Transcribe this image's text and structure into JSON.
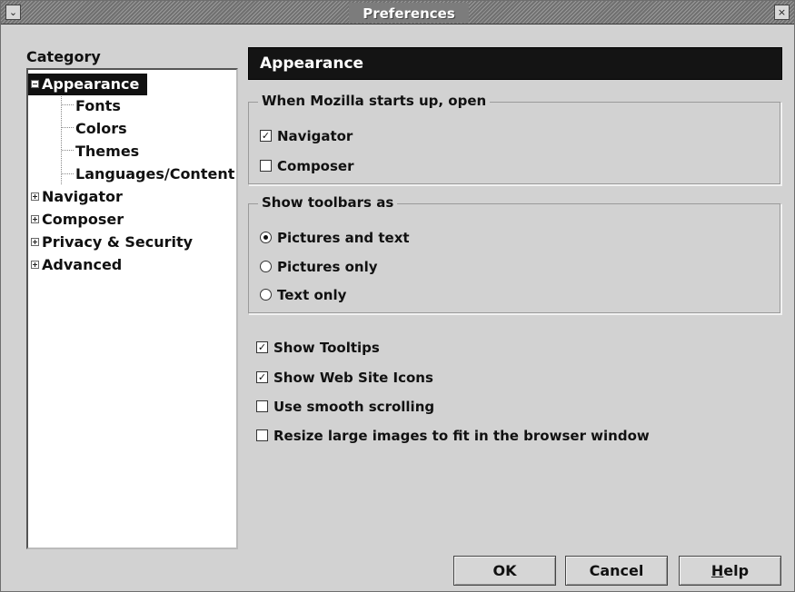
{
  "window": {
    "title": "Preferences",
    "menu_glyph": "⌄",
    "close_glyph": "×"
  },
  "category": {
    "label": "Category",
    "items": [
      {
        "label": "Appearance",
        "expander": "minus",
        "selected": true
      },
      {
        "label": "Fonts"
      },
      {
        "label": "Colors"
      },
      {
        "label": "Themes"
      },
      {
        "label": "Languages/Content"
      },
      {
        "label": "Navigator",
        "expander": "plus"
      },
      {
        "label": "Composer",
        "expander": "plus"
      },
      {
        "label": "Privacy & Security",
        "expander": "plus"
      },
      {
        "label": "Advanced",
        "expander": "plus"
      }
    ]
  },
  "panel": {
    "header": "Appearance",
    "startup": {
      "title": "When Mozilla starts up, open",
      "options": [
        {
          "label": "Navigator",
          "checked": true
        },
        {
          "label": "Composer",
          "checked": false
        }
      ]
    },
    "toolbars": {
      "title": "Show toolbars as",
      "options": [
        {
          "label": "Pictures and text",
          "selected": true
        },
        {
          "label": "Pictures only",
          "selected": false
        },
        {
          "label": "Text only",
          "selected": false
        }
      ]
    },
    "misc": [
      {
        "label": "Show Tooltips",
        "checked": true
      },
      {
        "label": "Show Web Site Icons",
        "checked": true
      },
      {
        "label": "Use smooth scrolling",
        "checked": false
      },
      {
        "label": "Resize large images to fit in the browser window",
        "checked": false
      }
    ]
  },
  "buttons": {
    "ok": "OK",
    "cancel": "Cancel",
    "help_rest": "elp",
    "help_mnemonic": "H"
  },
  "check_glyph": "✓"
}
